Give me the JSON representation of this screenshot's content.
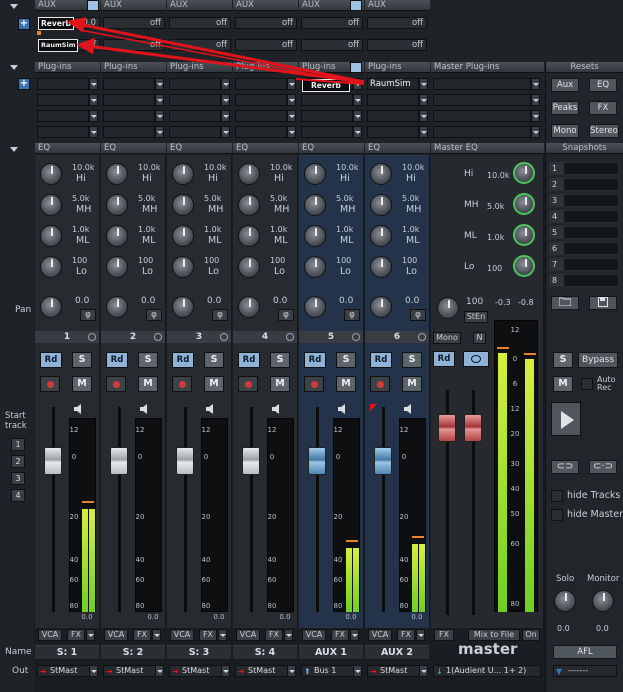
{
  "sections": {
    "aux": "AUX",
    "plugins": "Plug-ins",
    "master_plugins": "Master Plug-ins",
    "eq": "EQ",
    "master_eq": "Master EQ",
    "resets": "Resets",
    "snapshots": "Snapshots",
    "pan": "Pan",
    "start_track": "Start track",
    "name": "Name",
    "out": "Out"
  },
  "aux_values": {
    "row1": [
      "-10.0",
      "off",
      "off",
      "off",
      "off",
      "off"
    ],
    "row2": [
      "off",
      "off",
      "off",
      "off",
      "off",
      "off"
    ]
  },
  "popups": {
    "reverb": "Reverb",
    "raumsim": "RaumSim",
    "plugin_reverb": "Reverb",
    "plugin_raumsim": "RaumSim"
  },
  "eq_bands": {
    "hi": "Hi",
    "mh": "MH",
    "ml": "ML",
    "lo": "Lo",
    "hi_val": "10.0k",
    "mh_val": "5.0k",
    "ml_val": "1.0k",
    "lo_val": "100"
  },
  "pan_value": "0.0",
  "phase_symbol": "φ",
  "channels": [
    {
      "num": "1",
      "name": "S: 1",
      "out": "StMast",
      "fader": 0.65,
      "level": 0.72
    },
    {
      "num": "2",
      "name": "S: 2",
      "out": "StMast",
      "fader": 0.65,
      "level": 0
    },
    {
      "num": "3",
      "name": "S: 3",
      "out": "StMast",
      "fader": 0.65,
      "level": 0
    },
    {
      "num": "4",
      "name": "S: 4",
      "out": "StMast",
      "fader": 0.65,
      "level": 0
    },
    {
      "num": "5",
      "name": "AUX 1",
      "out": "Bus 1",
      "fader": 0.65,
      "level": 0.45
    },
    {
      "num": "6",
      "name": "AUX 2",
      "out": "StMast",
      "fader": 0.65,
      "level": 0.48
    }
  ],
  "buttons": {
    "rd": "Rd",
    "s": "S",
    "m": "M",
    "vca": "VCA",
    "fx": "FX",
    "mono": "Mono",
    "n": "N",
    "mix_to_file": "Mix to File",
    "on": "On",
    "sten": "StEn"
  },
  "fader_scale": [
    "12",
    "0",
    "20",
    "40",
    "60",
    "80",
    "0.0"
  ],
  "master": {
    "label": "master",
    "peak_l": "-0.3",
    "peak_r": "-0.8",
    "width": "100",
    "out": "1(Audient U... 1+ 2)",
    "level_l": 0.9,
    "level_r": 0.88
  },
  "master_scale": [
    "12",
    "0",
    "6",
    "12",
    "20",
    "30",
    "40",
    "50",
    "60",
    "80"
  ],
  "resets": [
    "Aux",
    "EQ",
    "Peaks",
    "FX",
    "Mono",
    "Stereo"
  ],
  "snapshots": [
    "1",
    "2",
    "3",
    "4",
    "5",
    "6",
    "7",
    "8"
  ],
  "right_panel": {
    "s": "S",
    "bypass": "Bypass",
    "m": "M",
    "auto_rec": "Auto Rec",
    "hide_tracks": "hide Tracks",
    "hide_master": "hide Master",
    "solo": "Solo",
    "monitor": "Monitor",
    "solo_val": "0.0",
    "monitor_val": "0.0",
    "afl": "AFL",
    "bottom_field": "-------"
  },
  "start_tracks": [
    "1",
    "2",
    "3",
    "4"
  ],
  "colors": {
    "accent_blue": "#8fb3d6",
    "meter_green": "#6fcf23",
    "annotation_red": "#e0141a"
  }
}
